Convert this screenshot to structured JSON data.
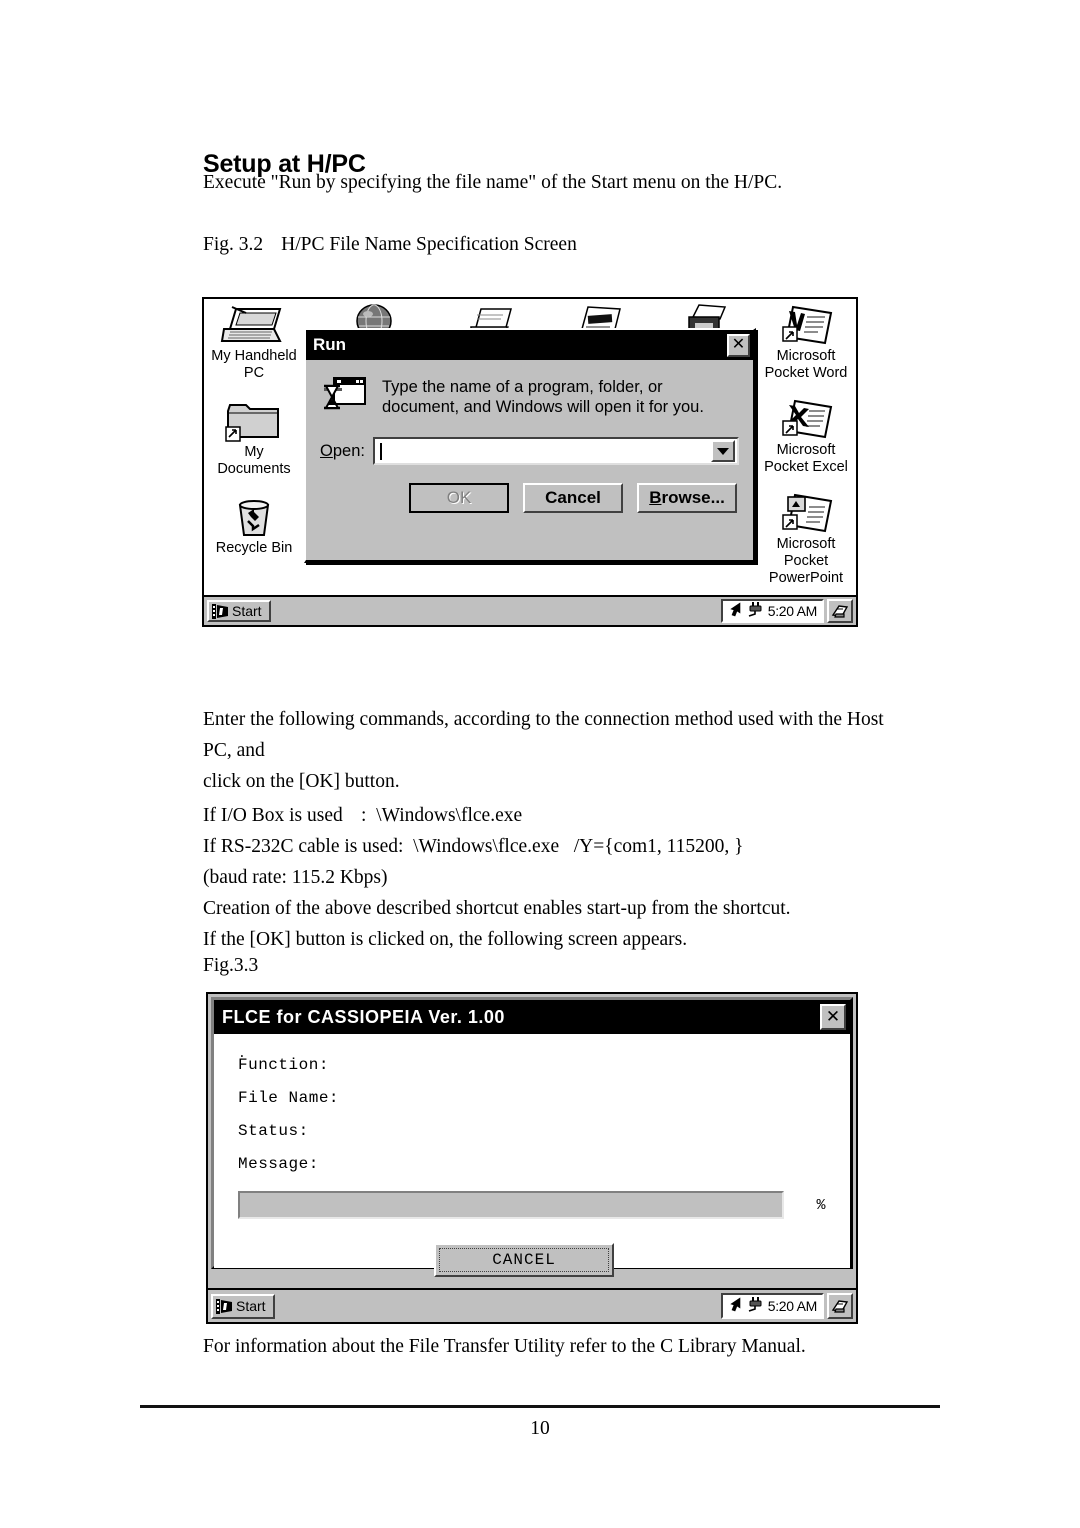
{
  "document": {
    "title": "Setup at H/PC",
    "intro": "Execute \"Run by specifying the file name\" of the Start menu on the H/PC.",
    "fig1_number": "Fig. 3.2",
    "fig1_caption": "H/PC File Name Specification Screen",
    "para_enter_line1": "Enter the following commands, according to the connection method used with the Host PC, and",
    "para_enter_line2": "click on the [OK] button.",
    "cmd1_label": "If I/O Box is used",
    "cmd1_sep": ":",
    "cmd1_value": "\\Windows\\flce.exe",
    "cmd2_label": "If RS-232C cable is used:",
    "cmd2_value": "\\Windows\\flce.exe   /Y={com1, 115200, }",
    "baud_note": "(baud rate: 115.2 Kbps)",
    "shortcut_note": "Creation of the above described shortcut enables start-up from the shortcut.",
    "ok_note": "If the [OK] button is clicked on, the following screen appears.",
    "fig2_number": "Fig.3.3",
    "closing": "For information about the File Transfer Utility refer to the C Library Manual.",
    "page_number": "10"
  },
  "screenshot1": {
    "desktop_icons_left": [
      {
        "name": "my-handheld-pc",
        "label": "My Handheld\nPC"
      },
      {
        "name": "my-documents",
        "label": "My\nDocuments"
      },
      {
        "name": "recycle-bin",
        "label": "Recycle Bin"
      }
    ],
    "desktop_icons_right": [
      {
        "name": "microsoft-pocket-word",
        "label": "Microsoft\nPocket Word"
      },
      {
        "name": "microsoft-pocket-excel",
        "label": "Microsoft\nPocket Excel"
      },
      {
        "name": "microsoft-pocket-powerpoint",
        "label": "Microsoft\nPocket\nPowerPoint"
      }
    ],
    "run_dialog": {
      "title": "Run",
      "close_label": "✕",
      "message_line1": "Type the name of a program, folder, or",
      "message_line2": "document, and Windows will open it for you.",
      "open_label_pre": "O",
      "open_label_post": "pen:",
      "open_value": "",
      "open_placeholder": "",
      "ok_label": "OK",
      "cancel_label": "Cancel",
      "browse_label_pre": "B",
      "browse_label_post": "rowse..."
    },
    "taskbar": {
      "start_label": "Start",
      "time": "5:20 AM"
    }
  },
  "screenshot2": {
    "flce_dialog": {
      "title": "FLCE for CASSIOPEIA  Ver. 1.00",
      "close_label": "✕",
      "dot": ".",
      "fields": [
        {
          "name": "function",
          "label": "Function:"
        },
        {
          "name": "file-name",
          "label": "File Name:"
        },
        {
          "name": "status",
          "label": "Status:"
        },
        {
          "name": "message",
          "label": "Message:"
        }
      ],
      "progress_percent_symbol": "%",
      "progress_value": 0,
      "cancel_label": "CANCEL"
    },
    "taskbar": {
      "start_label": "Start",
      "time": "5:20 AM"
    }
  }
}
